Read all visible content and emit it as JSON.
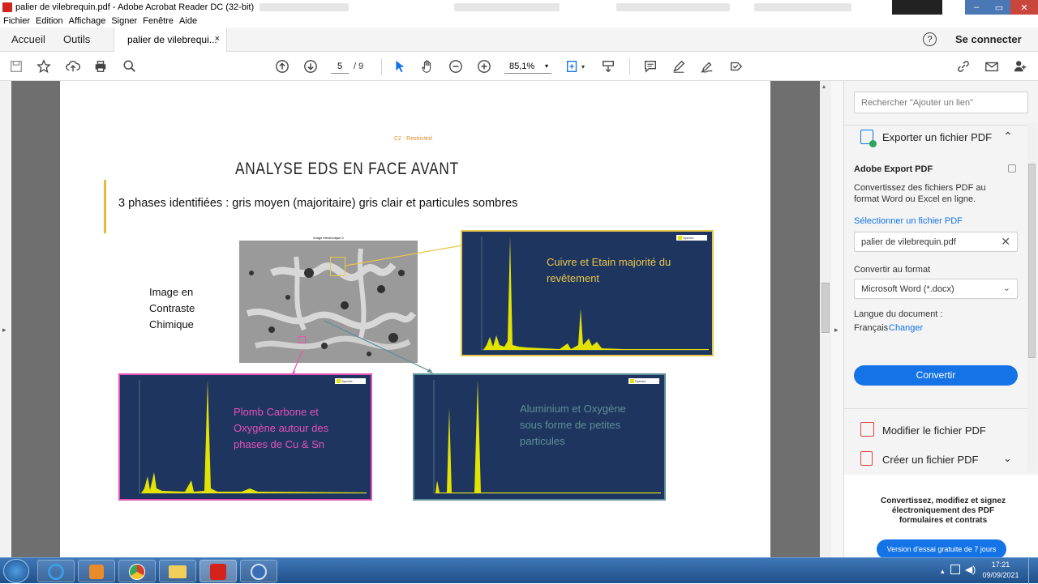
{
  "window": {
    "title": "palier de vilebrequin.pdf - Adobe Acrobat Reader DC (32-bit)"
  },
  "menu": [
    "Fichier",
    "Edition",
    "Affichage",
    "Signer",
    "Fenêtre",
    "Aide"
  ],
  "tabs": {
    "home": "Accueil",
    "tools": "Outils",
    "doc": "palier de vilebrequi...",
    "close": "×"
  },
  "account": {
    "help": "?",
    "signin": "Se connecter"
  },
  "toolbar": {
    "page_current": "5",
    "page_total": "/ 9",
    "zoom": "85,1%"
  },
  "doc": {
    "restricted": "C2 - Restricted",
    "title": "ANALYSE EDS EN FACE AVANT",
    "subtitle": "3 phases identifiées : gris moyen (majoritaire) gris clair et particules sombres",
    "image_label": "Image en Contraste Chimique",
    "image_caption": "Image électronique 2",
    "spectrum_legend": "Spectre",
    "spectra": [
      {
        "label": "Cuivre et Etain majorité du revêtement",
        "color": "#e8c64a"
      },
      {
        "label": "Plomb Carbone et Oxygène autour des phases de Cu & Sn",
        "color": "#e552b7"
      },
      {
        "label": "Aluminium et Oxygène sous forme de petites particules",
        "color": "#5e8f95"
      }
    ]
  },
  "panel": {
    "search_placeholder": "Rechercher \"Ajouter un lien\"",
    "export_title": "Exporter un fichier PDF",
    "adobe_export": "Adobe Export PDF",
    "export_desc": "Convertissez des fichiers PDF au format Word ou Excel en ligne.",
    "select_file": "Sélectionner un fichier PDF",
    "file_name": "palier de vilebrequin.pdf",
    "convert_to": "Convertir au format",
    "format": "Microsoft Word (*.docx)",
    "doc_lang": "Langue du document :",
    "lang": "Français",
    "change": "Changer",
    "convert_btn": "Convertir",
    "edit_pdf": "Modifier le fichier PDF",
    "create_pdf": "Créer un fichier PDF",
    "promo": "Convertissez, modifiez et signez électroniquement des PDF formulaires et contrats",
    "trial_btn": "Version d'essai gratuite de 7 jours"
  },
  "taskbar": {
    "time": "17:21",
    "date": "09/09/2021"
  },
  "colors": {
    "accent": "#1473e6",
    "navy": "#1e3560",
    "spectrum": "#e3e300"
  }
}
